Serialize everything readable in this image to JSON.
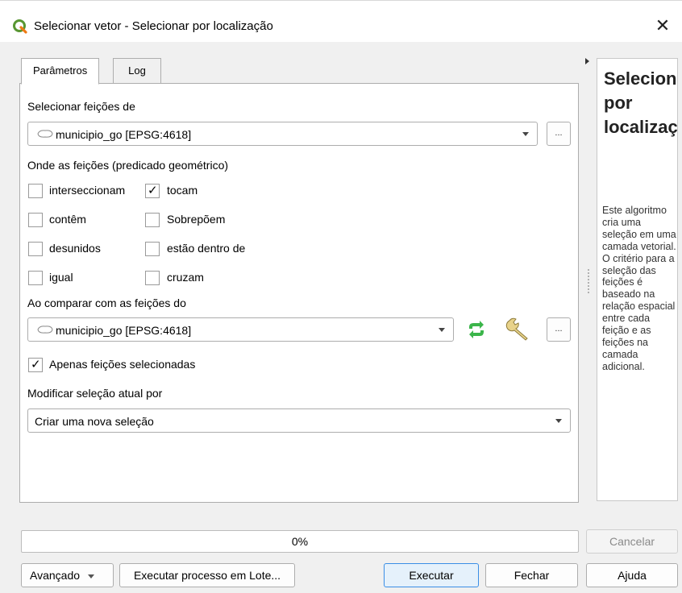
{
  "window": {
    "title": "Selecionar vetor - Selecionar por localização",
    "close_symbol": "✕",
    "app_icon": "qgis-icon"
  },
  "tabs": [
    {
      "label": "Parâmetros",
      "active": true
    },
    {
      "label": "Log",
      "active": false
    }
  ],
  "params": {
    "select_from_label": "Selecionar feições de",
    "select_from_value": "municipio_go [EPSG:4618]",
    "predicate_label": "Onde as feições (predicado geométrico)",
    "predicates": [
      {
        "label": "interseccionam",
        "checked": false
      },
      {
        "label": "tocam",
        "checked": true
      },
      {
        "label": "contêm",
        "checked": false
      },
      {
        "label": "Sobrepõem",
        "checked": false
      },
      {
        "label": "desunidos",
        "checked": false
      },
      {
        "label": "estão dentro de",
        "checked": false
      },
      {
        "label": "igual",
        "checked": false
      },
      {
        "label": "cruzam",
        "checked": false
      }
    ],
    "compare_label": "Ao comparar com as feições do",
    "compare_value": "municipio_go [EPSG:4618]",
    "only_selected_label": "Apenas feições selecionadas",
    "only_selected_checked": true,
    "modify_label": "Modificar seleção atual por",
    "modify_value": "Criar uma nova seleção",
    "ellipsis": "..."
  },
  "help": {
    "heading": "Selecionar por localização",
    "description": "Este algoritmo cria uma seleção em uma camada vetorial. O critério para a seleção das feições é baseado na relação espacial entre cada feição e as feições na camada adicional."
  },
  "progress": {
    "value": 0,
    "text": "0%"
  },
  "buttons": {
    "cancel": "Cancelar",
    "advanced": "Avançado",
    "batch": "Executar processo em Lote...",
    "run": "Executar",
    "close": "Fechar",
    "help": "Ajuda"
  },
  "colors": {
    "accent": "#3a8ee6",
    "refresh_icon": "#3bb54a",
    "progress_fill": "#06b025"
  }
}
